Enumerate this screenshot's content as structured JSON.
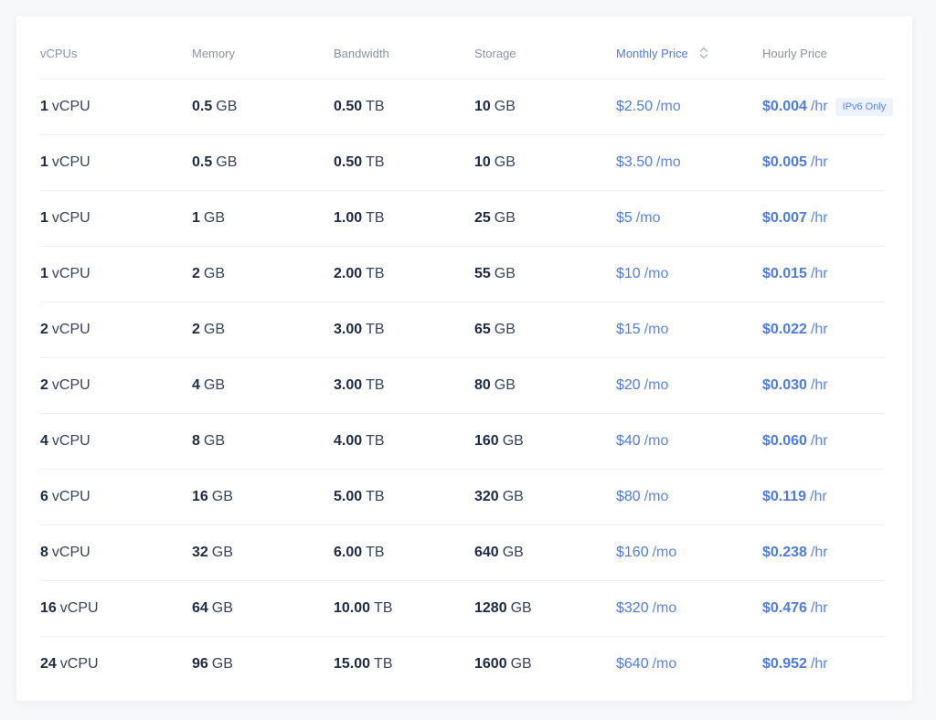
{
  "colors": {
    "accent": "#4e7ce6",
    "text_primary": "#1f2a44",
    "text_muted": "#8a93a3",
    "badge_bg": "#edf2fd"
  },
  "header": {
    "vcpus": "vCPUs",
    "memory": "Memory",
    "bandwidth": "Bandwidth",
    "storage": "Storage",
    "monthly_price": "Monthly Price",
    "hourly_price": "Hourly Price",
    "sort_icon": "sort-arrows-icon"
  },
  "rows": [
    {
      "vcpu": "1",
      "vcpu_unit": "vCPU",
      "mem": "0.5",
      "mem_unit": "GB",
      "bw": "0.50",
      "bw_unit": "TB",
      "st": "10",
      "st_unit": "GB",
      "mp": "$2.50",
      "mp_unit": "/mo",
      "hp": "$0.004",
      "hp_unit": "/hr",
      "badge": "IPv6 Only"
    },
    {
      "vcpu": "1",
      "vcpu_unit": "vCPU",
      "mem": "0.5",
      "mem_unit": "GB",
      "bw": "0.50",
      "bw_unit": "TB",
      "st": "10",
      "st_unit": "GB",
      "mp": "$3.50",
      "mp_unit": "/mo",
      "hp": "$0.005",
      "hp_unit": "/hr"
    },
    {
      "vcpu": "1",
      "vcpu_unit": "vCPU",
      "mem": "1",
      "mem_unit": "GB",
      "bw": "1.00",
      "bw_unit": "TB",
      "st": "25",
      "st_unit": "GB",
      "mp": "$5",
      "mp_unit": "/mo",
      "hp": "$0.007",
      "hp_unit": "/hr"
    },
    {
      "vcpu": "1",
      "vcpu_unit": "vCPU",
      "mem": "2",
      "mem_unit": "GB",
      "bw": "2.00",
      "bw_unit": "TB",
      "st": "55",
      "st_unit": "GB",
      "mp": "$10",
      "mp_unit": "/mo",
      "hp": "$0.015",
      "hp_unit": "/hr"
    },
    {
      "vcpu": "2",
      "vcpu_unit": "vCPU",
      "mem": "2",
      "mem_unit": "GB",
      "bw": "3.00",
      "bw_unit": "TB",
      "st": "65",
      "st_unit": "GB",
      "mp": "$15",
      "mp_unit": "/mo",
      "hp": "$0.022",
      "hp_unit": "/hr"
    },
    {
      "vcpu": "2",
      "vcpu_unit": "vCPU",
      "mem": "4",
      "mem_unit": "GB",
      "bw": "3.00",
      "bw_unit": "TB",
      "st": "80",
      "st_unit": "GB",
      "mp": "$20",
      "mp_unit": "/mo",
      "hp": "$0.030",
      "hp_unit": "/hr"
    },
    {
      "vcpu": "4",
      "vcpu_unit": "vCPU",
      "mem": "8",
      "mem_unit": "GB",
      "bw": "4.00",
      "bw_unit": "TB",
      "st": "160",
      "st_unit": "GB",
      "mp": "$40",
      "mp_unit": "/mo",
      "hp": "$0.060",
      "hp_unit": "/hr"
    },
    {
      "vcpu": "6",
      "vcpu_unit": "vCPU",
      "mem": "16",
      "mem_unit": "GB",
      "bw": "5.00",
      "bw_unit": "TB",
      "st": "320",
      "st_unit": "GB",
      "mp": "$80",
      "mp_unit": "/mo",
      "hp": "$0.119",
      "hp_unit": "/hr"
    },
    {
      "vcpu": "8",
      "vcpu_unit": "vCPU",
      "mem": "32",
      "mem_unit": "GB",
      "bw": "6.00",
      "bw_unit": "TB",
      "st": "640",
      "st_unit": "GB",
      "mp": "$160",
      "mp_unit": "/mo",
      "hp": "$0.238",
      "hp_unit": "/hr"
    },
    {
      "vcpu": "16",
      "vcpu_unit": "vCPU",
      "mem": "64",
      "mem_unit": "GB",
      "bw": "10.00",
      "bw_unit": "TB",
      "st": "1280",
      "st_unit": "GB",
      "mp": "$320",
      "mp_unit": "/mo",
      "hp": "$0.476",
      "hp_unit": "/hr"
    },
    {
      "vcpu": "24",
      "vcpu_unit": "vCPU",
      "mem": "96",
      "mem_unit": "GB",
      "bw": "15.00",
      "bw_unit": "TB",
      "st": "1600",
      "st_unit": "GB",
      "mp": "$640",
      "mp_unit": "/mo",
      "hp": "$0.952",
      "hp_unit": "/hr"
    }
  ]
}
